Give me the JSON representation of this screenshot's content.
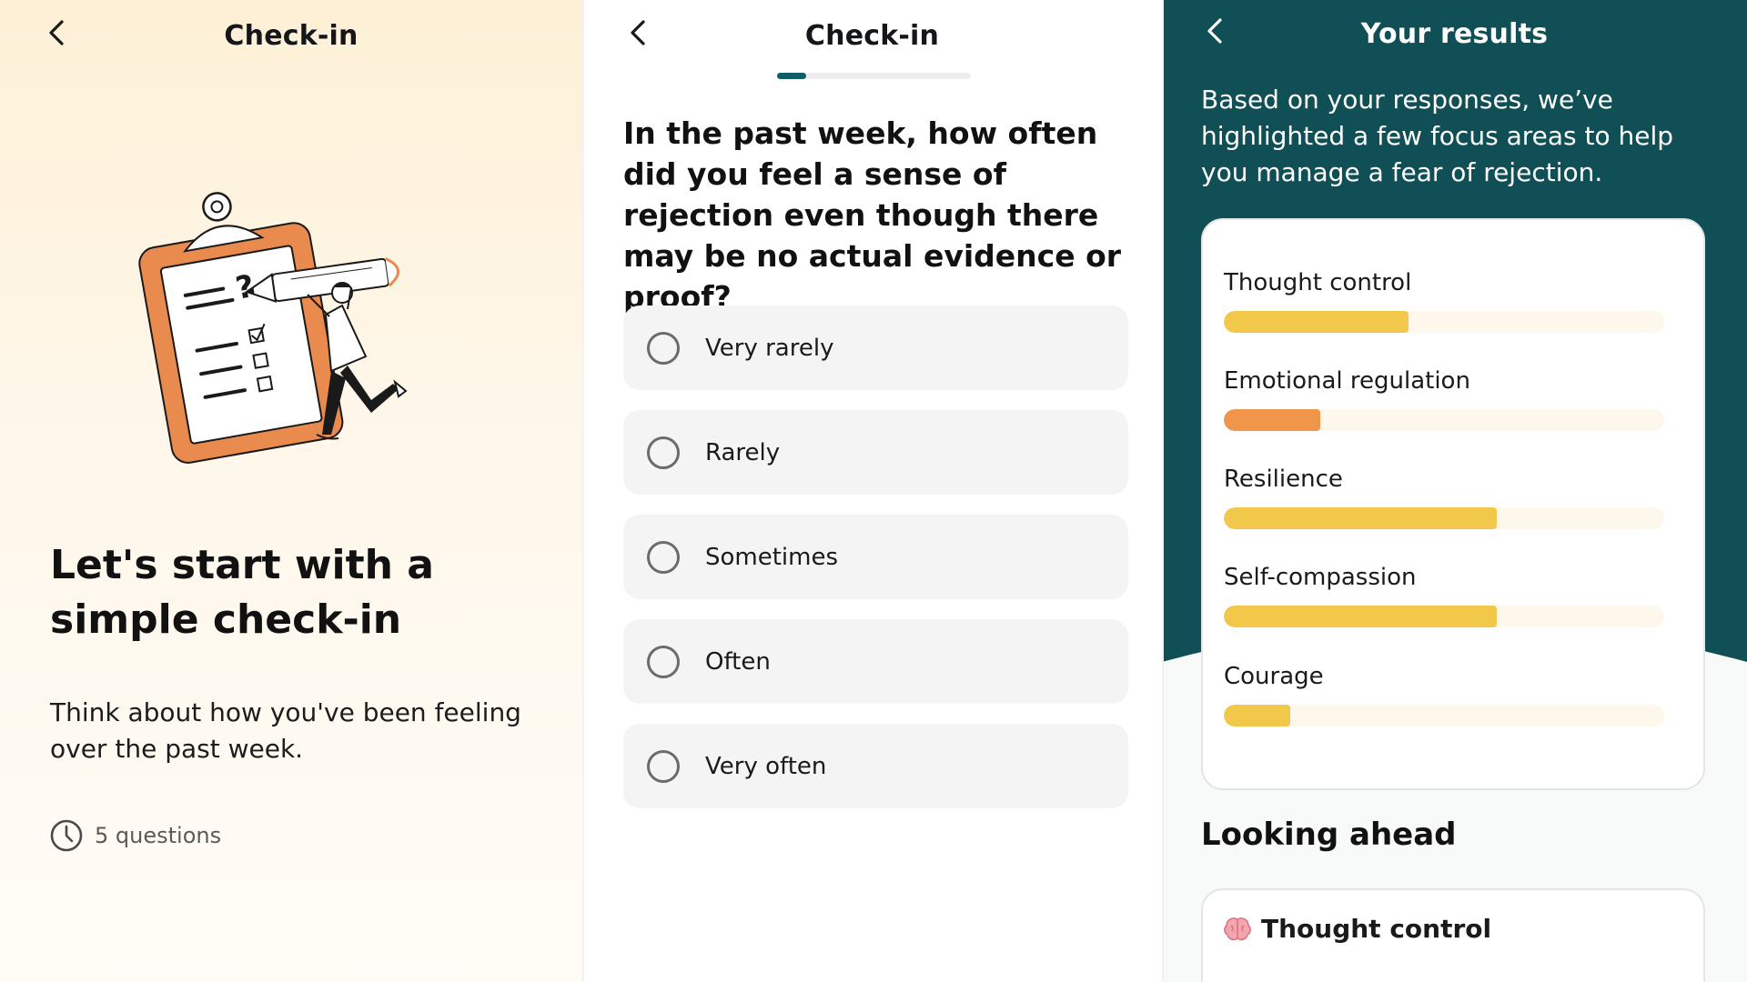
{
  "checkin_intro": {
    "header_title": "Check-in",
    "headline": "Let's start with a simple check-in",
    "description": "Think about how you've been feeling over the past week.",
    "question_count": "5 questions"
  },
  "checkin_question": {
    "header_title": "Check-in",
    "progress": 0.15,
    "question": "In the past week, how often did you feel a sense of rejection even though there may be no actual evidence or proof?",
    "options": [
      "Very rarely",
      "Rarely",
      "Sometimes",
      "Often",
      "Very often"
    ]
  },
  "results": {
    "header_title": "Your results",
    "intro": "Based on your responses, we’ve highlighted a few focus areas to help you manage a fear of rejection.",
    "metrics": [
      {
        "label": "Thought control",
        "value": 0.42,
        "color": "#f2c84b"
      },
      {
        "label": "Emotional regulation",
        "value": 0.22,
        "color": "#f0964a"
      },
      {
        "label": "Resilience",
        "value": 0.62,
        "color": "#f2c84b"
      },
      {
        "label": "Self-compassion",
        "value": 0.62,
        "color": "#f2c84b"
      },
      {
        "label": "Courage",
        "value": 0.15,
        "color": "#f2c84b"
      }
    ],
    "looking_ahead_title": "Looking ahead",
    "looking_ahead_card_title": "Thought control"
  },
  "colors": {
    "teal": "#0f4f55",
    "accent_orange": "#e98a4e",
    "bar_yellow": "#f2c84b",
    "bar_orange": "#f0964a"
  },
  "icons": {
    "back": "chevron-left-icon",
    "clock": "clock-icon",
    "radio": "radio-unchecked-icon",
    "brain": "brain-icon"
  }
}
